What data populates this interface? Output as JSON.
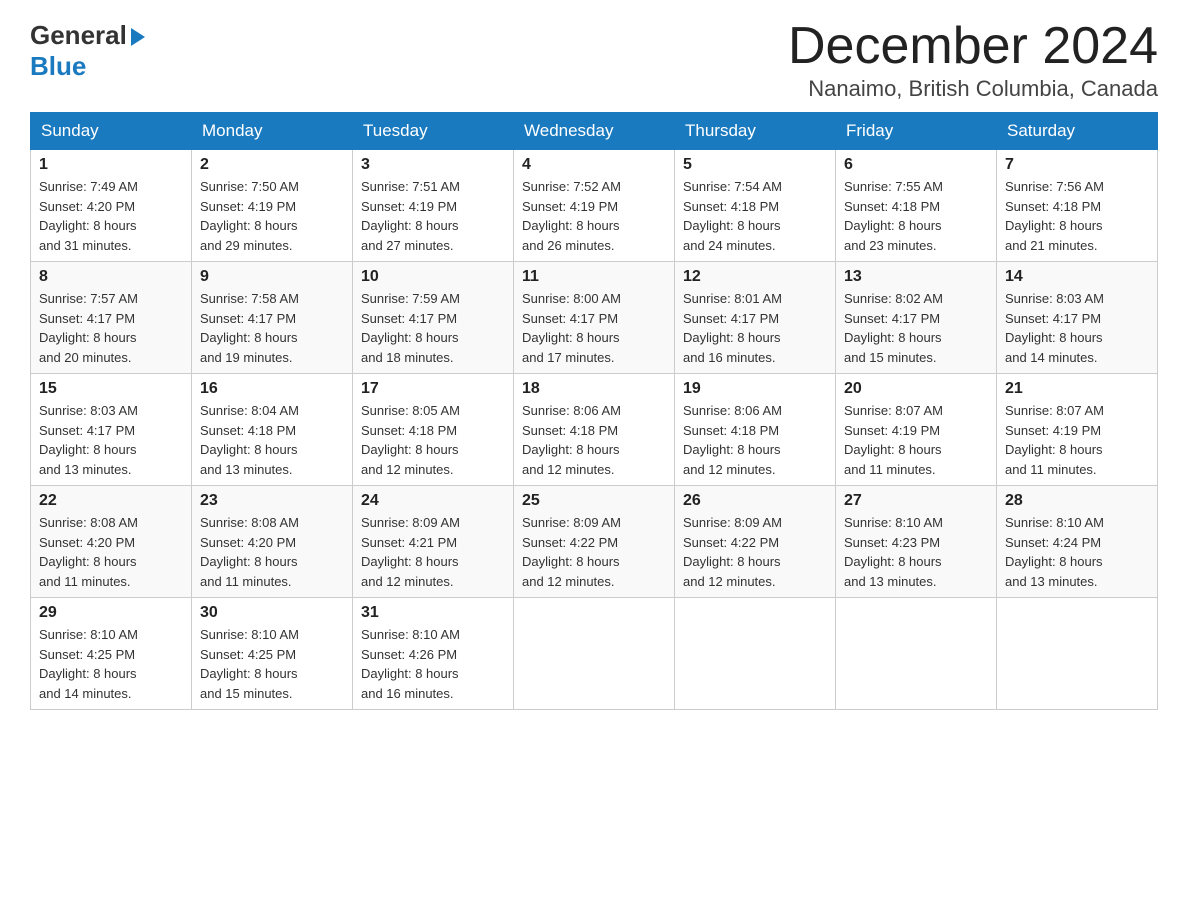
{
  "logo": {
    "line1": "General",
    "line2": "Blue"
  },
  "title": "December 2024",
  "subtitle": "Nanaimo, British Columbia, Canada",
  "days_of_week": [
    "Sunday",
    "Monday",
    "Tuesday",
    "Wednesday",
    "Thursday",
    "Friday",
    "Saturday"
  ],
  "weeks": [
    [
      {
        "day": "1",
        "sunrise": "7:49 AM",
        "sunset": "4:20 PM",
        "daylight": "8 hours and 31 minutes."
      },
      {
        "day": "2",
        "sunrise": "7:50 AM",
        "sunset": "4:19 PM",
        "daylight": "8 hours and 29 minutes."
      },
      {
        "day": "3",
        "sunrise": "7:51 AM",
        "sunset": "4:19 PM",
        "daylight": "8 hours and 27 minutes."
      },
      {
        "day": "4",
        "sunrise": "7:52 AM",
        "sunset": "4:19 PM",
        "daylight": "8 hours and 26 minutes."
      },
      {
        "day": "5",
        "sunrise": "7:54 AM",
        "sunset": "4:18 PM",
        "daylight": "8 hours and 24 minutes."
      },
      {
        "day": "6",
        "sunrise": "7:55 AM",
        "sunset": "4:18 PM",
        "daylight": "8 hours and 23 minutes."
      },
      {
        "day": "7",
        "sunrise": "7:56 AM",
        "sunset": "4:18 PM",
        "daylight": "8 hours and 21 minutes."
      }
    ],
    [
      {
        "day": "8",
        "sunrise": "7:57 AM",
        "sunset": "4:17 PM",
        "daylight": "8 hours and 20 minutes."
      },
      {
        "day": "9",
        "sunrise": "7:58 AM",
        "sunset": "4:17 PM",
        "daylight": "8 hours and 19 minutes."
      },
      {
        "day": "10",
        "sunrise": "7:59 AM",
        "sunset": "4:17 PM",
        "daylight": "8 hours and 18 minutes."
      },
      {
        "day": "11",
        "sunrise": "8:00 AM",
        "sunset": "4:17 PM",
        "daylight": "8 hours and 17 minutes."
      },
      {
        "day": "12",
        "sunrise": "8:01 AM",
        "sunset": "4:17 PM",
        "daylight": "8 hours and 16 minutes."
      },
      {
        "day": "13",
        "sunrise": "8:02 AM",
        "sunset": "4:17 PM",
        "daylight": "8 hours and 15 minutes."
      },
      {
        "day": "14",
        "sunrise": "8:03 AM",
        "sunset": "4:17 PM",
        "daylight": "8 hours and 14 minutes."
      }
    ],
    [
      {
        "day": "15",
        "sunrise": "8:03 AM",
        "sunset": "4:17 PM",
        "daylight": "8 hours and 13 minutes."
      },
      {
        "day": "16",
        "sunrise": "8:04 AM",
        "sunset": "4:18 PM",
        "daylight": "8 hours and 13 minutes."
      },
      {
        "day": "17",
        "sunrise": "8:05 AM",
        "sunset": "4:18 PM",
        "daylight": "8 hours and 12 minutes."
      },
      {
        "day": "18",
        "sunrise": "8:06 AM",
        "sunset": "4:18 PM",
        "daylight": "8 hours and 12 minutes."
      },
      {
        "day": "19",
        "sunrise": "8:06 AM",
        "sunset": "4:18 PM",
        "daylight": "8 hours and 12 minutes."
      },
      {
        "day": "20",
        "sunrise": "8:07 AM",
        "sunset": "4:19 PM",
        "daylight": "8 hours and 11 minutes."
      },
      {
        "day": "21",
        "sunrise": "8:07 AM",
        "sunset": "4:19 PM",
        "daylight": "8 hours and 11 minutes."
      }
    ],
    [
      {
        "day": "22",
        "sunrise": "8:08 AM",
        "sunset": "4:20 PM",
        "daylight": "8 hours and 11 minutes."
      },
      {
        "day": "23",
        "sunrise": "8:08 AM",
        "sunset": "4:20 PM",
        "daylight": "8 hours and 11 minutes."
      },
      {
        "day": "24",
        "sunrise": "8:09 AM",
        "sunset": "4:21 PM",
        "daylight": "8 hours and 12 minutes."
      },
      {
        "day": "25",
        "sunrise": "8:09 AM",
        "sunset": "4:22 PM",
        "daylight": "8 hours and 12 minutes."
      },
      {
        "day": "26",
        "sunrise": "8:09 AM",
        "sunset": "4:22 PM",
        "daylight": "8 hours and 12 minutes."
      },
      {
        "day": "27",
        "sunrise": "8:10 AM",
        "sunset": "4:23 PM",
        "daylight": "8 hours and 13 minutes."
      },
      {
        "day": "28",
        "sunrise": "8:10 AM",
        "sunset": "4:24 PM",
        "daylight": "8 hours and 13 minutes."
      }
    ],
    [
      {
        "day": "29",
        "sunrise": "8:10 AM",
        "sunset": "4:25 PM",
        "daylight": "8 hours and 14 minutes."
      },
      {
        "day": "30",
        "sunrise": "8:10 AM",
        "sunset": "4:25 PM",
        "daylight": "8 hours and 15 minutes."
      },
      {
        "day": "31",
        "sunrise": "8:10 AM",
        "sunset": "4:26 PM",
        "daylight": "8 hours and 16 minutes."
      },
      null,
      null,
      null,
      null
    ]
  ],
  "labels": {
    "sunrise": "Sunrise:",
    "sunset": "Sunset:",
    "daylight": "Daylight:"
  }
}
